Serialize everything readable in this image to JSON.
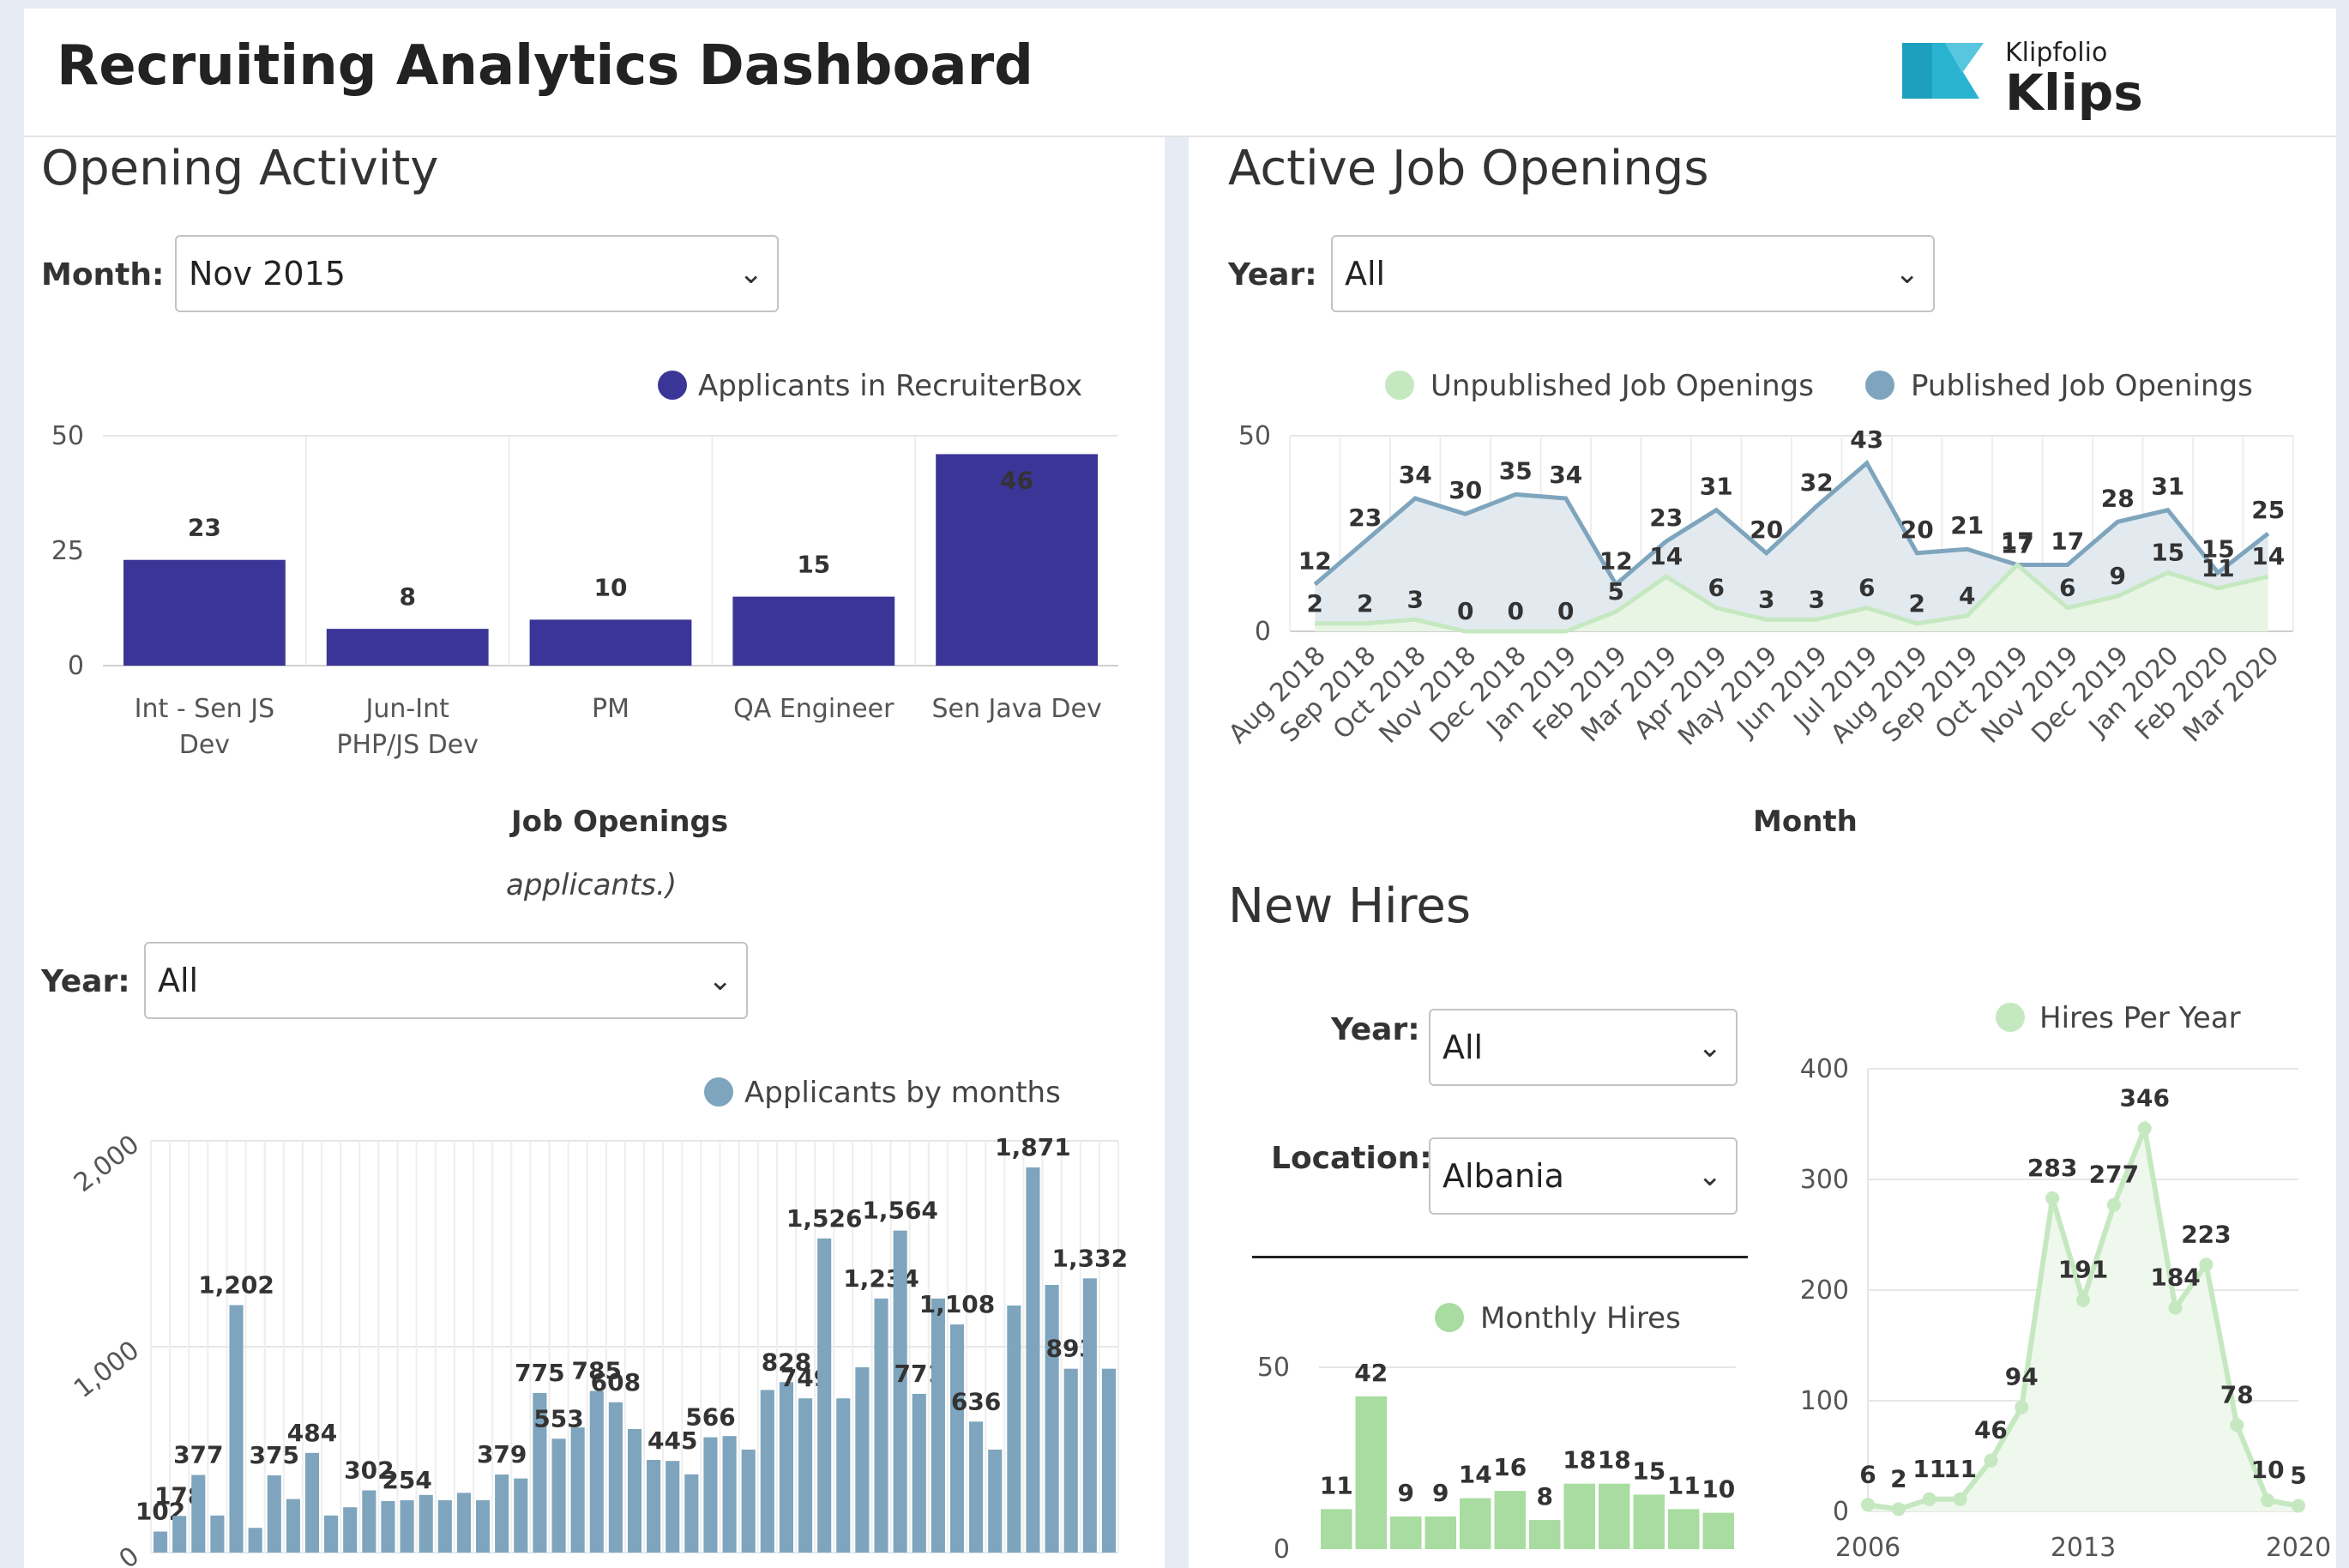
{
  "header": {
    "title": "Recruiting Analytics Dashboard",
    "logo_small": "Klipfolio",
    "logo_big": "Klips"
  },
  "opening_activity": {
    "title": "Opening Activity",
    "month_label": "Month:",
    "month_value": "Nov 2015",
    "legend": "Applicants in RecruiterBox",
    "xlabel": "Job Openings",
    "note": "applicants.)",
    "chart_data": {
      "type": "bar",
      "categories": [
        "Int - Sen JS Dev",
        "Jun-Int PHP/JS Dev",
        "PM",
        "QA Engineer",
        "Sen Java Dev"
      ],
      "values": [
        23,
        8,
        10,
        15,
        46
      ],
      "ylim": [
        0,
        50
      ],
      "yticks": [
        "0",
        "25",
        "50"
      ],
      "color": "#3b3597",
      "series_name": "Applicants in RecruiterBox"
    }
  },
  "applicants_by_month": {
    "year_label": "Year:",
    "year_value": "All",
    "legend": "Applicants by months",
    "chart_data": {
      "type": "bar",
      "values": [
        102,
        178,
        377,
        180,
        1202,
        120,
        375,
        260,
        484,
        180,
        220,
        302,
        250,
        254,
        280,
        254,
        290,
        254,
        379,
        360,
        775,
        553,
        608,
        785,
        730,
        600,
        450,
        445,
        380,
        560,
        566,
        500,
        790,
        828,
        749,
        1526,
        749,
        900,
        1234,
        1564,
        771,
        1234,
        1108,
        636,
        500,
        1200,
        1871,
        1300,
        893,
        1332,
        893
      ],
      "labels": {
        "0": "102",
        "1": "178",
        "2": "377",
        "4": "1,202",
        "6": "375",
        "8": "484",
        "11": "302",
        "13": "254",
        "18": "379",
        "20": "775",
        "21": "553",
        "23": "785",
        "24": "608",
        "27": "445",
        "29": "566",
        "33": "828",
        "34": "749",
        "35": "1,526",
        "38": "1,234",
        "39": "1,564",
        "40": "771",
        "42": "1,108",
        "43": "636",
        "46": "1,871",
        "48": "893",
        "49": "1,332"
      },
      "ylim": [
        0,
        2000
      ],
      "yticks": [
        "0",
        "1,000",
        "2,000"
      ],
      "color": "#7ea5bd"
    }
  },
  "active_job_openings": {
    "title": "Active Job Openings",
    "year_label": "Year:",
    "year_value": "All",
    "legend_unpublished": "Unpublished Job Openings",
    "legend_published": "Published Job Openings",
    "xlabel": "Month",
    "chart_data": {
      "type": "area",
      "categories": [
        "Aug 2018",
        "Sep 2018",
        "Oct 2018",
        "Nov 2018",
        "Dec 2018",
        "Jan 2019",
        "Feb 2019",
        "Mar 2019",
        "Apr 2019",
        "May 2019",
        "Jun 2019",
        "Jul 2019",
        "Aug 2019",
        "Sep 2019",
        "Oct 2019",
        "Nov 2019",
        "Dec 2019",
        "Jan 2020",
        "Feb 2020",
        "Mar 2020"
      ],
      "series": [
        {
          "name": "Unpublished Job Openings",
          "color": "#c5e8c0",
          "values": [
            2,
            2,
            3,
            0,
            0,
            0,
            5,
            14,
            6,
            3,
            3,
            6,
            2,
            4,
            17,
            6,
            9,
            15,
            11,
            14
          ]
        },
        {
          "name": "Published Job Openings",
          "color": "#7ea5bd",
          "values": [
            12,
            23,
            34,
            30,
            35,
            34,
            12,
            23,
            31,
            20,
            32,
            43,
            20,
            21,
            17,
            17,
            28,
            31,
            15,
            25
          ]
        }
      ],
      "ylim": [
        0,
        50
      ],
      "yticks": [
        "0",
        "50"
      ]
    }
  },
  "new_hires": {
    "title": "New Hires",
    "year_label": "Year:",
    "year_value": "All",
    "location_label": "Location:",
    "location_value": "Albania",
    "monthly_legend": "Monthly Hires",
    "monthly_chart": {
      "type": "bar",
      "values": [
        11,
        42,
        9,
        9,
        14,
        16,
        8,
        18,
        18,
        15,
        11,
        10
      ],
      "ylim": [
        0,
        50
      ],
      "yticks": [
        "0",
        "50"
      ],
      "color": "#a8dca0"
    },
    "yearly_legend": "Hires Per Year",
    "yearly_chart": {
      "type": "area",
      "x": [
        2006,
        2007,
        2008,
        2009,
        2010,
        2011,
        2012,
        2013,
        2014,
        2015,
        2016,
        2017,
        2018,
        2019,
        2020
      ],
      "values": [
        6,
        2,
        11,
        11,
        46,
        94,
        283,
        191,
        277,
        346,
        184,
        223,
        78,
        10,
        5
      ],
      "ylim": [
        0,
        400
      ],
      "yticks": [
        "0",
        "100",
        "200",
        "300",
        "400"
      ],
      "xticks": [
        "2006",
        "2013",
        "2020"
      ],
      "color": "#c5e8c0"
    }
  }
}
